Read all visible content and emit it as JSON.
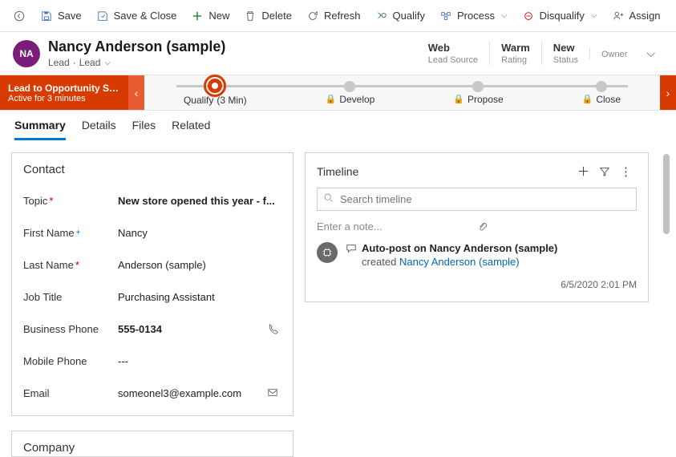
{
  "toolbar": {
    "save": "Save",
    "save_close": "Save & Close",
    "new": "New",
    "delete": "Delete",
    "refresh": "Refresh",
    "qualify": "Qualify",
    "process": "Process",
    "disqualify": "Disqualify",
    "assign": "Assign"
  },
  "header": {
    "avatar_initials": "NA",
    "title": "Nancy Anderson (sample)",
    "entity": "Lead",
    "form_label": "Lead",
    "cells": [
      {
        "value": "Web",
        "label": "Lead Source"
      },
      {
        "value": "Warm",
        "label": "Rating"
      },
      {
        "value": "New",
        "label": "Status"
      },
      {
        "value": "",
        "label": "Owner"
      }
    ]
  },
  "bpf": {
    "flag_title": "Lead to Opportunity Sale...",
    "flag_sub": "Active for 3 minutes",
    "stages": [
      {
        "label": "Qualify",
        "meta": "(3 Min)",
        "active": true
      },
      {
        "label": "Develop",
        "locked": true
      },
      {
        "label": "Propose",
        "locked": true
      },
      {
        "label": "Close",
        "locked": true
      }
    ]
  },
  "tabs": [
    "Summary",
    "Details",
    "Files",
    "Related"
  ],
  "active_tab": "Summary",
  "contact": {
    "section_title": "Contact",
    "fields": {
      "topic": {
        "label": "Topic",
        "value": "New store opened this year - f...",
        "required": true,
        "bold": true
      },
      "first_name": {
        "label": "First Name",
        "value": "Nancy",
        "recommended": true
      },
      "last_name": {
        "label": "Last Name",
        "value": "Anderson (sample)",
        "required": true
      },
      "job_title": {
        "label": "Job Title",
        "value": "Purchasing Assistant"
      },
      "business_phone": {
        "label": "Business Phone",
        "value": "555-0134",
        "bold": true,
        "icon": "phone"
      },
      "mobile_phone": {
        "label": "Mobile Phone",
        "value": "---"
      },
      "email": {
        "label": "Email",
        "value": "someonel3@example.com",
        "icon": "mail"
      }
    }
  },
  "company": {
    "section_title": "Company"
  },
  "timeline": {
    "title": "Timeline",
    "search_placeholder": "Search timeline",
    "note_placeholder": "Enter a note...",
    "post": {
      "title": "Auto-post on Nancy Anderson (sample)",
      "action": "created",
      "who": "Nancy Anderson (sample)",
      "time": "6/5/2020 2:01 PM"
    }
  }
}
